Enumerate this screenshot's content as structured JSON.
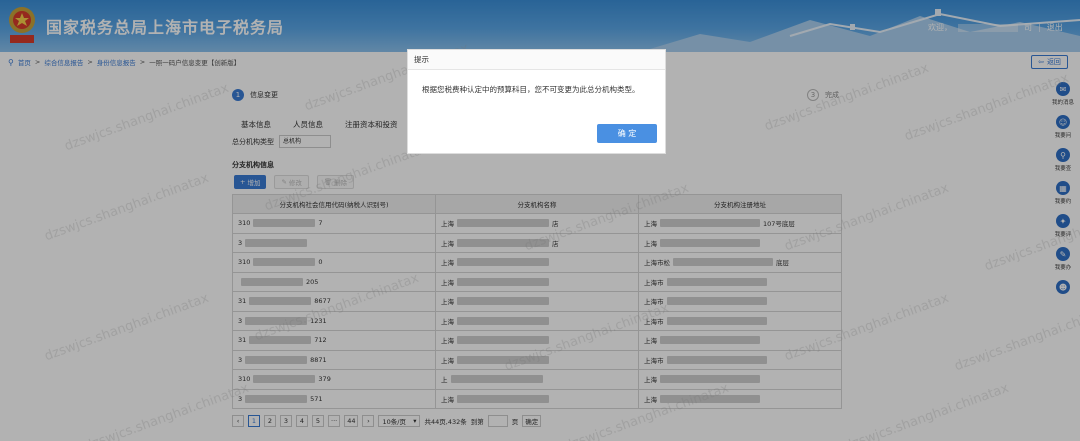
{
  "header": {
    "site_title": "国家税务总局上海市电子税务局",
    "welcome": "欢迎，",
    "user_suffix": "司",
    "separator": "|",
    "logout": "退出"
  },
  "breadcrumb": {
    "home": "首页",
    "sep": ">",
    "items": [
      "综合信息报告",
      "身份信息报告",
      "一照一码户信息变更【创新版】"
    ]
  },
  "back_button": "返回",
  "steps": {
    "step1_num": "1",
    "step1_label": "信息变更",
    "step3_num": "3",
    "step3_label": "完成"
  },
  "tabs": [
    "基本信息",
    "人员信息",
    "注册资本和投资"
  ],
  "branch_type": {
    "label": "总分机构类型",
    "value": "总机构"
  },
  "section_title": "分支机构信息",
  "toolbar": {
    "add": "增加",
    "edit": "修改",
    "delete": "删除"
  },
  "table": {
    "headers": [
      "分支机构社会信用代码(纳税人识别号)",
      "分支机构名称",
      "分支机构注册地址"
    ],
    "rows": [
      {
        "c1_pre": "310",
        "c1_suf": "7",
        "c2_pre": "上海",
        "c2_suf": "店",
        "c3_pre": "上海",
        "c3_suf": "107号底层"
      },
      {
        "c1_pre": "3",
        "c1_suf": "",
        "c2_pre": "上海",
        "c2_suf": "店",
        "c3_pre": "上海",
        "c3_suf": ""
      },
      {
        "c1_pre": "310",
        "c1_suf": "0",
        "c2_pre": "上海",
        "c2_suf": "",
        "c3_pre": "上海市松",
        "c3_suf": "底层"
      },
      {
        "c1_pre": "",
        "c1_suf": "205",
        "c2_pre": "上海",
        "c2_suf": "",
        "c3_pre": "上海市",
        "c3_suf": ""
      },
      {
        "c1_pre": "31",
        "c1_suf": "8677",
        "c2_pre": "上海",
        "c2_suf": "",
        "c3_pre": "上海市",
        "c3_suf": ""
      },
      {
        "c1_pre": "3",
        "c1_suf": "1231",
        "c2_pre": "上海",
        "c2_suf": "",
        "c3_pre": "上海市",
        "c3_suf": ""
      },
      {
        "c1_pre": "31",
        "c1_suf": "712",
        "c2_pre": "上海",
        "c2_suf": "",
        "c3_pre": "上海",
        "c3_suf": ""
      },
      {
        "c1_pre": "3",
        "c1_suf": "8871",
        "c2_pre": "上海",
        "c2_suf": "",
        "c3_pre": "上海市",
        "c3_suf": ""
      },
      {
        "c1_pre": "310",
        "c1_suf": "379",
        "c2_pre": "上",
        "c2_suf": "",
        "c3_pre": "上海",
        "c3_suf": ""
      },
      {
        "c1_pre": "3",
        "c1_suf": "571",
        "c2_pre": "上海",
        "c2_suf": "",
        "c3_pre": "上海",
        "c3_suf": ""
      }
    ]
  },
  "pager": {
    "prev": "‹",
    "pages": [
      "1",
      "2",
      "3",
      "4",
      "5"
    ],
    "ellipsis": "···",
    "last": "44",
    "next": "›",
    "page_size": "10条/页",
    "summary": "共44页,432条",
    "goto_label": "到第",
    "page_unit": "页",
    "confirm": "确定"
  },
  "sidebar": [
    {
      "icon": "chat-icon",
      "glyph": "✉",
      "label": "我的消息"
    },
    {
      "icon": "service-icon",
      "glyph": "☺",
      "label": "我要问"
    },
    {
      "icon": "search-icon",
      "glyph": "⚲",
      "label": "我要查"
    },
    {
      "icon": "calendar-icon",
      "glyph": "▦",
      "label": "我要约"
    },
    {
      "icon": "review-icon",
      "glyph": "✦",
      "label": "我要评"
    },
    {
      "icon": "edit-icon",
      "glyph": "✎",
      "label": "我要办"
    },
    {
      "icon": "robot-icon",
      "glyph": "☻",
      "label": ""
    }
  ],
  "watermark": "dzswjcs.shanghai.chinatax",
  "modal": {
    "title": "提示",
    "message": "根据您税费种认定中的预算科目，您不可变更为此总分机构类型。",
    "ok": "确 定"
  },
  "colors": {
    "primary": "#3a7bd5",
    "header": "#4a9ae0",
    "overlay": "rgba(0,0,0,0.30)"
  }
}
